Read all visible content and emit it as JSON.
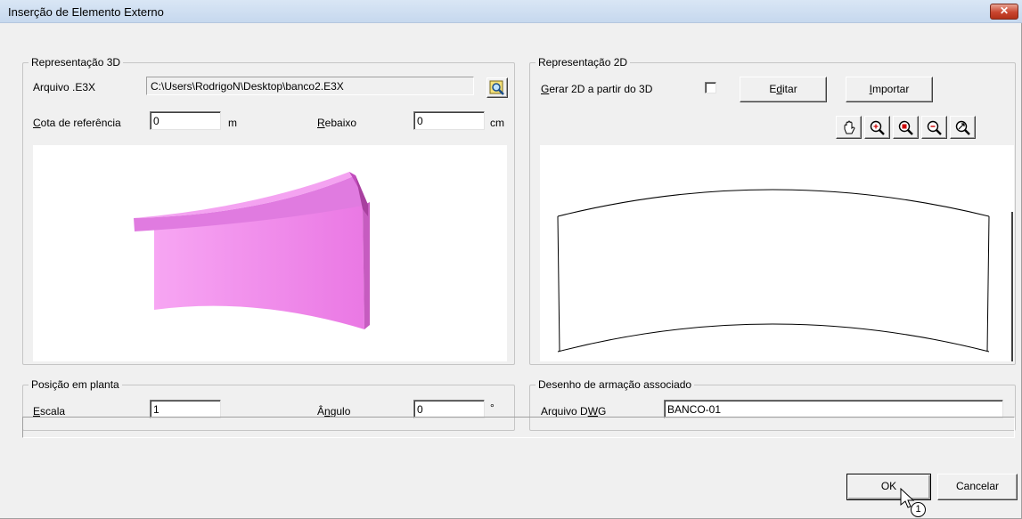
{
  "window": {
    "title": "Inserção de Elemento Externo",
    "close_glyph": "✕"
  },
  "group3d": {
    "label": "Representação 3D",
    "file_label": "Arquivo .E3X",
    "file_value": "C:\\Users\\RodrigoN\\Desktop\\banco2.E3X",
    "browse_icon": "browse-file-icon",
    "cota_label_u": "C",
    "cota_label_rest": "ota de referência",
    "cota_value": "0",
    "cota_unit": "m",
    "rebaixo_label_u": "R",
    "rebaixo_label_rest": "ebaixo",
    "rebaixo_value": "0",
    "rebaixo_unit": "cm",
    "preview_color": "#ee82ee"
  },
  "group2d": {
    "label": "Representação 2D",
    "gerar_label_u": "G",
    "gerar_label_rest": "erar 2D a partir do 3D",
    "gerar_checked": false,
    "edit_pre": "E",
    "edit_u": "d",
    "edit_post": "itar",
    "import_u": "I",
    "import_rest": "mportar",
    "tools": [
      "pan-icon",
      "zoom-window-icon",
      "zoom-extents-icon",
      "zoom-out-icon",
      "zoom-realtime-icon"
    ]
  },
  "posicao": {
    "label": "Posição em planta",
    "escala_label_u": "E",
    "escala_label_rest": "scala",
    "escala_value": "1",
    "angulo_label_pre": "Â",
    "angulo_label_u": "n",
    "angulo_label_post": "gulo",
    "angulo_value": "0",
    "angulo_unit": "°"
  },
  "desenho": {
    "label": "Desenho de armação associado",
    "dwg_label_pre": "Arquivo D",
    "dwg_label_u": "W",
    "dwg_label_post": "G",
    "dwg_value": "BANCO-01"
  },
  "footer": {
    "ok_label": "OK",
    "cancel_label": "Cancelar",
    "cursor_badge": "1"
  }
}
